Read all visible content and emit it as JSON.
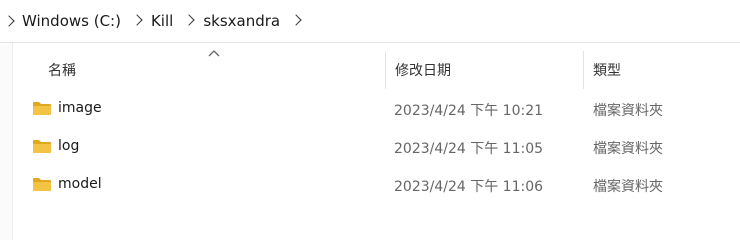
{
  "breadcrumb": {
    "items": [
      "Windows (C:)",
      "Kill",
      "sksxandra"
    ]
  },
  "columns": {
    "name": "名稱",
    "modified": "修改日期",
    "type": "類型"
  },
  "files": [
    {
      "name": "image",
      "modified": "2023/4/24 下午 10:21",
      "type": "檔案資料夾"
    },
    {
      "name": "log",
      "modified": "2023/4/24 下午 11:05",
      "type": "檔案資料夾"
    },
    {
      "name": "model",
      "modified": "2023/4/24 下午 11:06",
      "type": "檔案資料夾"
    }
  ],
  "colors": {
    "folder": "#f3c344",
    "folder_dark": "#e0a81e"
  }
}
